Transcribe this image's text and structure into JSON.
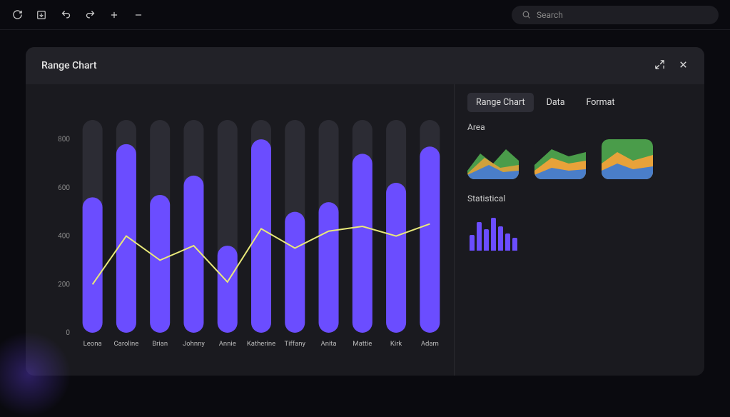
{
  "toolbar": {
    "search_placeholder": "Search"
  },
  "card": {
    "title": "Range Chart"
  },
  "tabs": {
    "t1": "Range Chart",
    "t2": "Data",
    "t3": "Format"
  },
  "sections": {
    "area": "Area",
    "statistical": "Statistical"
  },
  "chart_data": {
    "type": "bar",
    "categories": [
      "Leona",
      "Caroline",
      "Brian",
      "Johnny",
      "Annie",
      "Katherine",
      "Tiffany",
      "Anita",
      "Mattie",
      "Kirk",
      "Adam"
    ],
    "values": [
      560,
      780,
      570,
      650,
      360,
      800,
      500,
      540,
      740,
      620,
      770
    ],
    "line_values": [
      200,
      400,
      300,
      360,
      210,
      430,
      350,
      420,
      440,
      400,
      450
    ],
    "bg_value": 880,
    "title": "Range Chart",
    "xlabel": "",
    "ylabel": "",
    "ylim": [
      0,
      880
    ],
    "y_ticks": [
      0,
      200,
      400,
      600,
      800
    ]
  }
}
